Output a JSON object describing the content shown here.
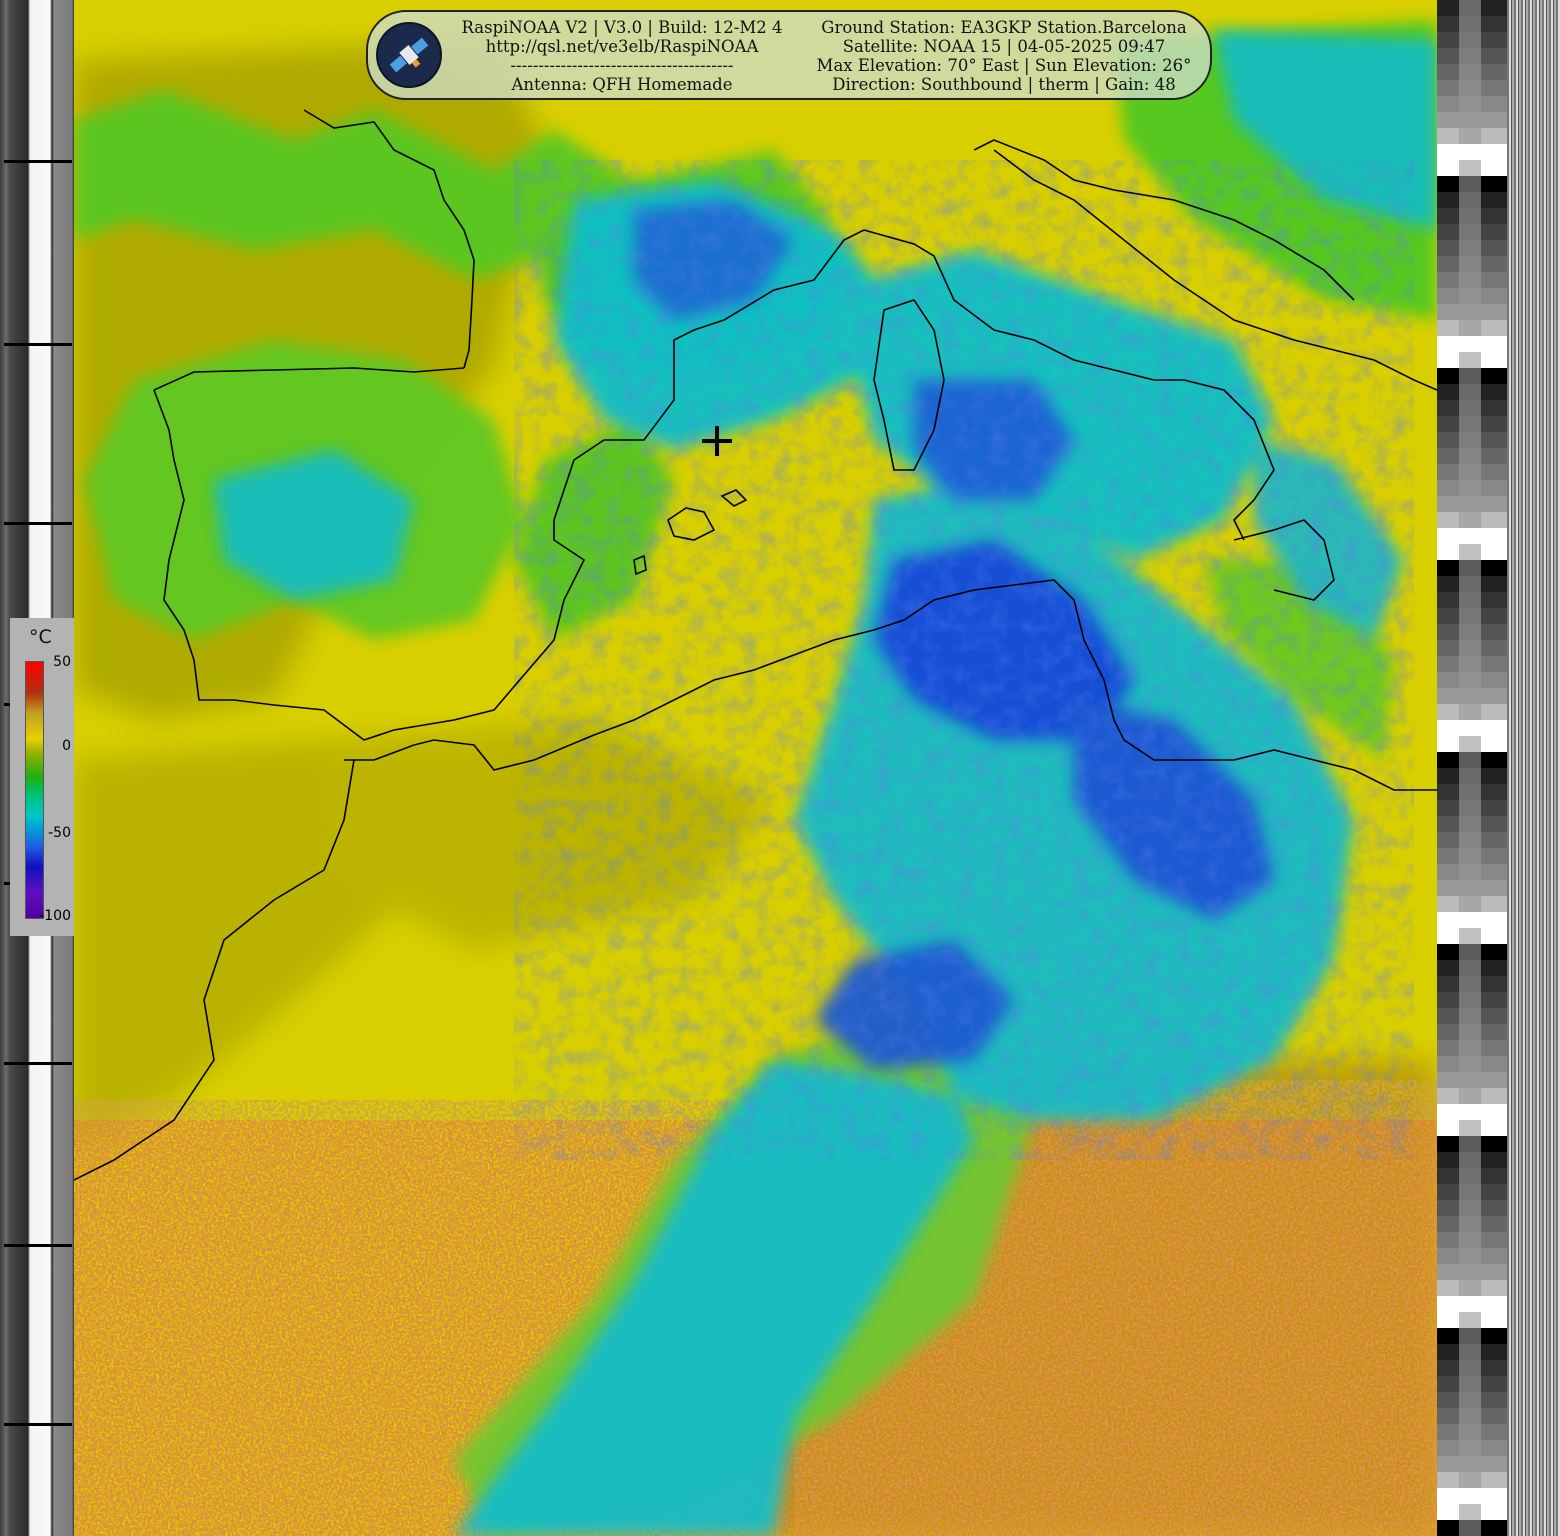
{
  "hud": {
    "left_lines": [
      "RaspiNOAA V2 | V3.0 | Build: 12-M2 4",
      "http://qsl.net/ve3elb/RaspiNOAA",
      "----------------------------------------",
      "Antenna: QFH Homemade"
    ],
    "right_lines": [
      "Ground Station: EA3GKP Station.Barcelona",
      "Satellite: NOAA 15 | 04-05-2025 09:47",
      "Max Elevation: 70° East | Sun Elevation: 26°",
      "Direction: Southbound | therm | Gain: 48"
    ],
    "logo_icon": "satellite-icon"
  },
  "legend": {
    "unit": "°C",
    "labels": [
      "50",
      "0",
      "-50",
      "-100"
    ]
  },
  "marker_icon": "crosshair-icon",
  "colors": {
    "warm": "#e0d400",
    "cold": "#1a4fd6",
    "cyan": "#00c0c0",
    "green": "#40c020",
    "hot": "#a8700a"
  }
}
